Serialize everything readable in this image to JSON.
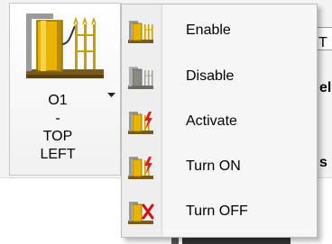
{
  "ribbon": {
    "big_button": {
      "line1": "O1",
      "line2": "-",
      "line3": "TOP",
      "line4": "LEFT",
      "icon": "switch-panel-icon"
    }
  },
  "background": {
    "frag1": "T",
    "frag2": "els",
    "frag3": "s"
  },
  "menu": {
    "items": [
      {
        "label": "Enable",
        "icon": "enable-icon"
      },
      {
        "label": "Disable",
        "icon": "disable-icon"
      },
      {
        "label": "Activate",
        "icon": "activate-icon"
      },
      {
        "label": "Turn ON",
        "icon": "turn-on-icon"
      },
      {
        "label": "Turn OFF",
        "icon": "turn-off-icon"
      }
    ]
  },
  "colors": {
    "device_yellow": "#e8b400",
    "device_gray": "#8a8a80",
    "lightning_red": "#e02020",
    "off_red": "#d01010"
  }
}
